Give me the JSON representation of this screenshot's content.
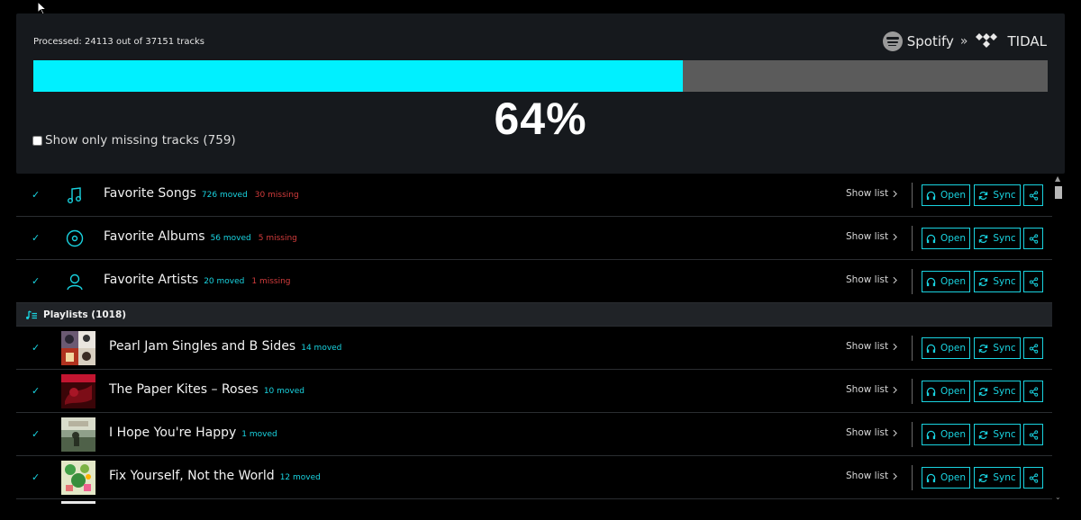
{
  "progress": {
    "processed_text": "Processed: 24113 out of 37151 tracks",
    "fraction": 0.64,
    "percent_label": "64%",
    "fill_color": "#00f0ff"
  },
  "brand": {
    "source": "Spotify",
    "separator": "»",
    "target": "TIDAL"
  },
  "filter": {
    "label": "Show only missing tracks (759)",
    "checked": false
  },
  "favorites": [
    {
      "name": "Favorite Songs",
      "moved": "726 moved",
      "missing": "30 missing",
      "icon": "music-note-icon",
      "check": "✓",
      "show_list": "Show list"
    },
    {
      "name": "Favorite Albums",
      "moved": "56 moved",
      "missing": "5 missing",
      "icon": "disc-icon",
      "check": "✓",
      "show_list": "Show list"
    },
    {
      "name": "Favorite Artists",
      "moved": "20 moved",
      "missing": "1 missing",
      "icon": "person-icon",
      "check": "✓",
      "show_list": "Show list"
    }
  ],
  "playlists_header": "Playlists (1018)",
  "playlists": [
    {
      "name": "Pearl Jam Singles and B Sides",
      "moved": "14 moved",
      "check": "✓",
      "show_list": "Show list"
    },
    {
      "name": "The Paper Kites – Roses",
      "moved": "10 moved",
      "check": "✓",
      "show_list": "Show list"
    },
    {
      "name": "I Hope You're Happy",
      "moved": "1 moved",
      "check": "✓",
      "show_list": "Show list"
    },
    {
      "name": "Fix Yourself, Not the World",
      "moved": "12 moved",
      "check": "✓",
      "show_list": "Show list"
    }
  ],
  "buttons": {
    "open": "Open",
    "sync": "Sync"
  },
  "colors": {
    "accent": "#19d3e0",
    "missing": "#d23c3c",
    "panel": "#16191d"
  }
}
